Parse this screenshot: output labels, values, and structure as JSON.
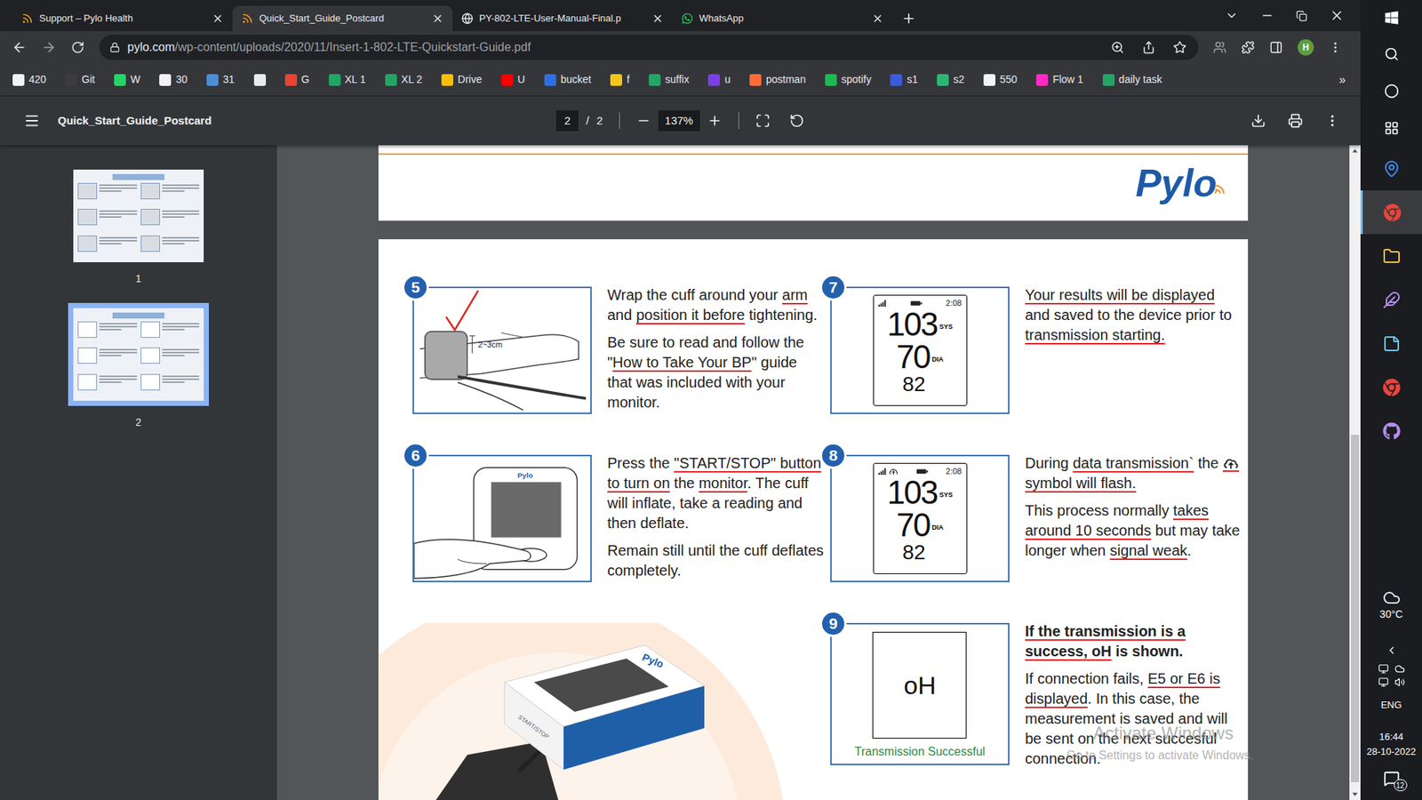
{
  "browser": {
    "tabs": [
      {
        "title": "Support – Pylo Health",
        "kind": "pylo",
        "selected": false
      },
      {
        "title": "Quick_Start_Guide_Postcard",
        "kind": "pylo",
        "selected": true
      },
      {
        "title": "PY-802-LTE-User-Manual-Final.p",
        "kind": "globe",
        "selected": false
      },
      {
        "title": "WhatsApp",
        "kind": "whatsapp",
        "selected": false
      }
    ],
    "address": {
      "host": "pylo.com",
      "path": "/wp-content/uploads/2020/11/Insert-1-802-LTE-Quickstart-Guide.pdf"
    },
    "profile": "H",
    "bookmarks": [
      {
        "label": "420",
        "color": "#f1f3f4"
      },
      {
        "label": "Git",
        "color": "#3c3c3c"
      },
      {
        "label": "W",
        "color": "#25d366"
      },
      {
        "label": "30",
        "color": "#f1f3f4"
      },
      {
        "label": "31",
        "color": "#4a8fd9"
      },
      {
        "label": "",
        "color": "#e8eaed"
      },
      {
        "label": "G",
        "color": "#ea4335"
      },
      {
        "label": "XL 1",
        "color": "#23a566"
      },
      {
        "label": "XL 2",
        "color": "#23a566"
      },
      {
        "label": "Drive",
        "color": "#fbbc04"
      },
      {
        "label": "U",
        "color": "#ff0000"
      },
      {
        "label": "bucket",
        "color": "#2f6fe4"
      },
      {
        "label": "f",
        "color": "#f5c518"
      },
      {
        "label": "suffix",
        "color": "#23a566"
      },
      {
        "label": "u",
        "color": "#7b3fe4"
      },
      {
        "label": "postman",
        "color": "#ff6c37"
      },
      {
        "label": "spotify",
        "color": "#1db954"
      },
      {
        "label": "s1",
        "color": "#3b5bdb"
      },
      {
        "label": "s2",
        "color": "#2bb673"
      },
      {
        "label": "550",
        "color": "#f1f3f4"
      },
      {
        "label": "Flow 1",
        "color": "#ff2bc2"
      },
      {
        "label": "daily task",
        "color": "#23a566"
      }
    ],
    "bookmarks_more": "»"
  },
  "pdf_toolbar": {
    "title": "Quick_Start_Guide_Postcard",
    "page": "2",
    "separator": "/",
    "pages": "2",
    "zoom": "137%"
  },
  "thumbnails": [
    {
      "label": "1",
      "selected": false
    },
    {
      "label": "2",
      "selected": true
    }
  ],
  "scrollbar": {
    "position": 0.44,
    "size": 0.55
  },
  "page1": {
    "logo": "Pylo"
  },
  "page2": {
    "columns": [
      [
        {
          "number": "5",
          "figure": {
            "kind": "cuff",
            "label": "2~3cm"
          },
          "paragraphs": [
            {
              "bold": false,
              "segments": [
                {
                  "kind": "text",
                  "text": "Wrap the cuff around your ",
                  "marked": false
                },
                {
                  "kind": "text",
                  "text": "arm",
                  "marked": true
                },
                {
                  "kind": "text",
                  "text": " and ",
                  "marked": false
                },
                {
                  "kind": "text",
                  "text": "position it before",
                  "marked": true
                },
                {
                  "kind": "text",
                  "text": " tightening.",
                  "marked": false
                }
              ]
            },
            {
              "bold": false,
              "segments": [
                {
                  "kind": "text",
                  "text": "Be sure to read and follow the \"",
                  "marked": false
                },
                {
                  "kind": "text",
                  "text": "How to Take Your BP",
                  "marked": true
                },
                {
                  "kind": "text",
                  "text": "\" guide that was included with your monitor.",
                  "marked": false
                }
              ]
            }
          ]
        },
        {
          "number": "6",
          "figure": {
            "kind": "button",
            "logo": "Pylo"
          },
          "paragraphs": [
            {
              "bold": false,
              "segments": [
                {
                  "kind": "text",
                  "text": "Press the ",
                  "marked": false
                },
                {
                  "kind": "text",
                  "text": "\"START/STOP\" button to turn on",
                  "marked": true
                },
                {
                  "kind": "text",
                  "text": " the ",
                  "marked": false
                },
                {
                  "kind": "text",
                  "text": "monitor",
                  "marked": true
                },
                {
                  "kind": "text",
                  "text": ". The cuff will inflate, take a reading and then deflate.",
                  "marked": false
                }
              ]
            },
            {
              "bold": false,
              "segments": [
                {
                  "kind": "text",
                  "text": "Remain still until the cuff deflates completely.",
                  "marked": false
                }
              ]
            }
          ]
        }
      ],
      [
        {
          "number": "7",
          "figure": {
            "kind": "lcd",
            "upload": false,
            "time": "2:08",
            "sys": "103",
            "sys_label": "SYS",
            "dia": "70",
            "dia_label": "DIA",
            "pulse": "82"
          },
          "paragraphs": [
            {
              "bold": false,
              "segments": [
                {
                  "kind": "text",
                  "text": "Your results will be displayed",
                  "marked": true
                },
                {
                  "kind": "text",
                  "text": " and saved to the device prior to ",
                  "marked": false
                },
                {
                  "kind": "text",
                  "text": "transmission starting.",
                  "marked": true
                }
              ]
            }
          ]
        },
        {
          "number": "8",
          "figure": {
            "kind": "lcd",
            "upload": true,
            "time": "2:08",
            "sys": "103",
            "sys_label": "SYS",
            "dia": "70",
            "dia_label": "DIA",
            "pulse": "82"
          },
          "paragraphs": [
            {
              "bold": false,
              "segments": [
                {
                  "kind": "text",
                  "text": "During ",
                  "marked": false
                },
                {
                  "kind": "text",
                  "text": "data transmission`",
                  "marked": true
                },
                {
                  "kind": "text",
                  "text": " the ",
                  "marked": false
                },
                {
                  "kind": "icon",
                  "text": "",
                  "marked": true
                },
                {
                  "kind": "text",
                  "text": " symbol will flash.",
                  "marked": true
                }
              ]
            },
            {
              "bold": false,
              "segments": [
                {
                  "kind": "text",
                  "text": "This process normally ",
                  "marked": false
                },
                {
                  "kind": "text",
                  "text": "takes around 10 seconds",
                  "marked": true
                },
                {
                  "kind": "text",
                  "text": " but may take longer when ",
                  "marked": false
                },
                {
                  "kind": "text",
                  "text": "signal weak",
                  "marked": true
                },
                {
                  "kind": "text",
                  "text": ".",
                  "marked": false
                }
              ]
            }
          ]
        },
        {
          "number": "9",
          "figure": {
            "kind": "done",
            "code": "oH",
            "caption": "Transmission Successful"
          },
          "paragraphs": [
            {
              "bold": true,
              "segments": [
                {
                  "kind": "text",
                  "text": "If the transmission is a success, ",
                  "marked": true
                },
                {
                  "kind": "text",
                  "text": "oH",
                  "marked": true
                },
                {
                  "kind": "text",
                  "text": " is shown.",
                  "marked": false
                }
              ]
            },
            {
              "bold": false,
              "segments": [
                {
                  "kind": "text",
                  "text": "If connection fails, ",
                  "marked": false
                },
                {
                  "kind": "text",
                  "text": "E5 or E6 is displayed",
                  "marked": true
                },
                {
                  "kind": "text",
                  "text": ". In this case, the measurement is saved and will be sent on the next succesful connection.",
                  "marked": false
                }
              ]
            }
          ]
        }
      ]
    ],
    "device": {
      "logo": "Pylo",
      "button": "START/STOP"
    }
  },
  "watermark": {
    "title": "Activate Windows",
    "subtitle": "Go to Settings to activate Windows."
  },
  "taskbar": {
    "apps": [
      {
        "kind": "maps",
        "selected": false
      },
      {
        "kind": "chrome",
        "selected": true
      },
      {
        "kind": "files",
        "selected": false
      },
      {
        "kind": "pen",
        "selected": false
      },
      {
        "kind": "notes",
        "selected": false
      },
      {
        "kind": "chrome",
        "selected": false
      },
      {
        "kind": "github",
        "selected": false
      }
    ],
    "temperature": "30°C",
    "language": "ENG",
    "time": "16:44",
    "date": "28-10-2022",
    "notifications": "12"
  }
}
